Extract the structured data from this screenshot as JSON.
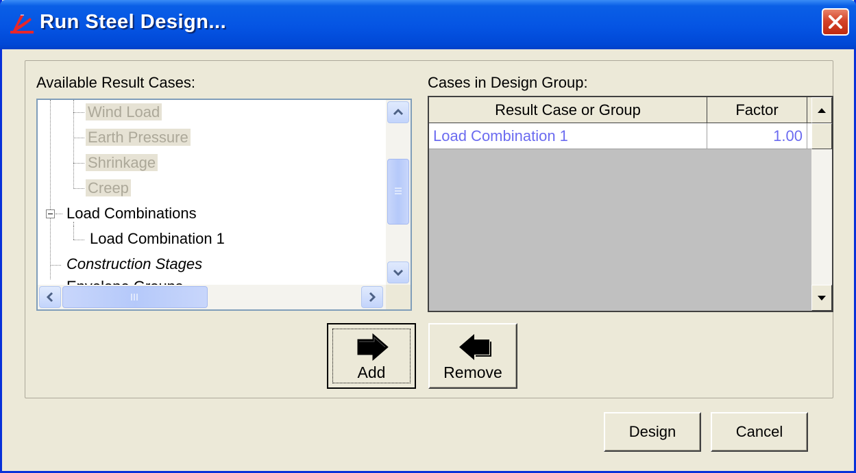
{
  "window": {
    "title": "Run Steel Design..."
  },
  "left": {
    "label": "Available Result Cases:",
    "tree": [
      {
        "text": "Wind Load",
        "level": 2,
        "disabled": true
      },
      {
        "text": "Earth Pressure",
        "level": 2,
        "disabled": true
      },
      {
        "text": "Shrinkage",
        "level": 2,
        "disabled": true
      },
      {
        "text": "Creep",
        "level": 2,
        "disabled": true
      },
      {
        "text": "Load Combinations",
        "level": 1,
        "disabled": false,
        "expander": "minus"
      },
      {
        "text": "Load Combination 1",
        "level": 2,
        "disabled": false
      },
      {
        "text": "Construction Stages",
        "level": 1,
        "disabled": false,
        "italic": true
      },
      {
        "text": "Envelope Groups",
        "level": 1,
        "disabled": false
      }
    ]
  },
  "right": {
    "label": "Cases in Design Group:",
    "columns": [
      "Result Case or Group",
      "Factor"
    ],
    "rows": [
      {
        "case": "Load Combination 1",
        "factor": "1.00"
      }
    ]
  },
  "buttons": {
    "add": "Add",
    "remove": "Remove",
    "design": "Design",
    "cancel": "Cancel"
  },
  "colors": {
    "title_bar": "#0554e3",
    "selected_text": "#6b6bf0",
    "close": "#d4432a"
  }
}
